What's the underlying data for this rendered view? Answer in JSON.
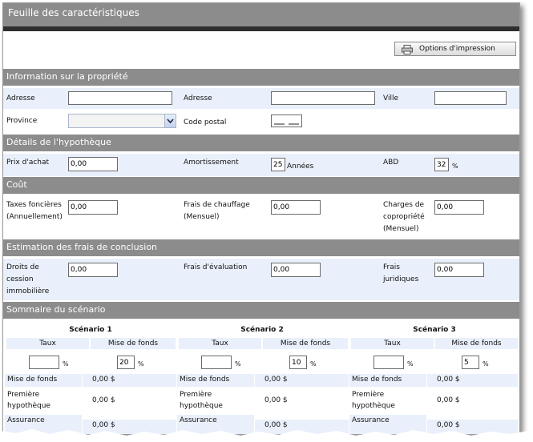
{
  "window": {
    "title": "Feuille des caractéristiques"
  },
  "toolbar": {
    "print_label": "Options d'impression"
  },
  "sections": {
    "property": "Information sur la propriété",
    "mortgage": "Détails de l'hypothèque",
    "cost": "Coût",
    "closing": "Estimation des frais de conclusion",
    "summary": "Sommaire du scénario"
  },
  "property": {
    "address1_label": "Adresse",
    "address1_value": "",
    "address2_label": "Adresse",
    "address2_value": "",
    "city_label": "Ville",
    "city_value": "",
    "province_label": "Province",
    "province_value": "",
    "postal_label": "Code postal"
  },
  "mortgage": {
    "price_label": "Prix d'achat",
    "price_value": "0,00",
    "amort_label": "Amortissement",
    "amort_value": "25",
    "amort_unit": "Années",
    "abd_label": "ABD",
    "abd_value": "32",
    "abd_unit": "%"
  },
  "cost": {
    "tax_label1": "Taxes foncières",
    "tax_label2": "(Annuellement)",
    "tax_value": "0,00",
    "heat_label1": "Frais de chauffage",
    "heat_label2": "(Mensuel)",
    "heat_value": "0,00",
    "condo_label1": "Charges de",
    "condo_label2": "copropriété",
    "condo_label3": "(Mensuel)",
    "condo_value": "0,00"
  },
  "closing": {
    "duty_label1": "Droits de",
    "duty_label2": "cession",
    "duty_label3": "immobilière",
    "duty_value": "0,00",
    "appraisal_label": "Frais d'évaluation",
    "appraisal_value": "0,00",
    "legal_label1": "Frais",
    "legal_label2": "juridiques",
    "legal_value": "0,00"
  },
  "summary": {
    "scenarios": [
      {
        "title": "Scénario 1",
        "rate_header": "Taux",
        "down_header": "Mise de fonds",
        "rate_value": "",
        "down_value": "20",
        "rows": [
          {
            "label": "Mise de fonds",
            "value": "0,00 $"
          },
          {
            "label": "Première hypothèque",
            "value": "0,00 $"
          },
          {
            "label": "Assurance",
            "value": "0,00 $"
          }
        ]
      },
      {
        "title": "Scénario 2",
        "rate_header": "Taux",
        "down_header": "Mise de fonds",
        "rate_value": "",
        "down_value": "10",
        "rows": [
          {
            "label": "Mise de fonds",
            "value": "0,00 $"
          },
          {
            "label": "Première hypothèque",
            "value": "0,00 $"
          },
          {
            "label": "Assurance",
            "value": "0,00 $"
          }
        ]
      },
      {
        "title": "Scénario 3",
        "rate_header": "Taux",
        "down_header": "Mise de fonds",
        "rate_value": "",
        "down_value": "5",
        "rows": [
          {
            "label": "Mise de fonds",
            "value": "0,00 $"
          },
          {
            "label": "Première hypothèque",
            "value": "0,00 $"
          },
          {
            "label": "Assurance",
            "value": "0,00 $"
          }
        ]
      }
    ],
    "percent": "%"
  }
}
